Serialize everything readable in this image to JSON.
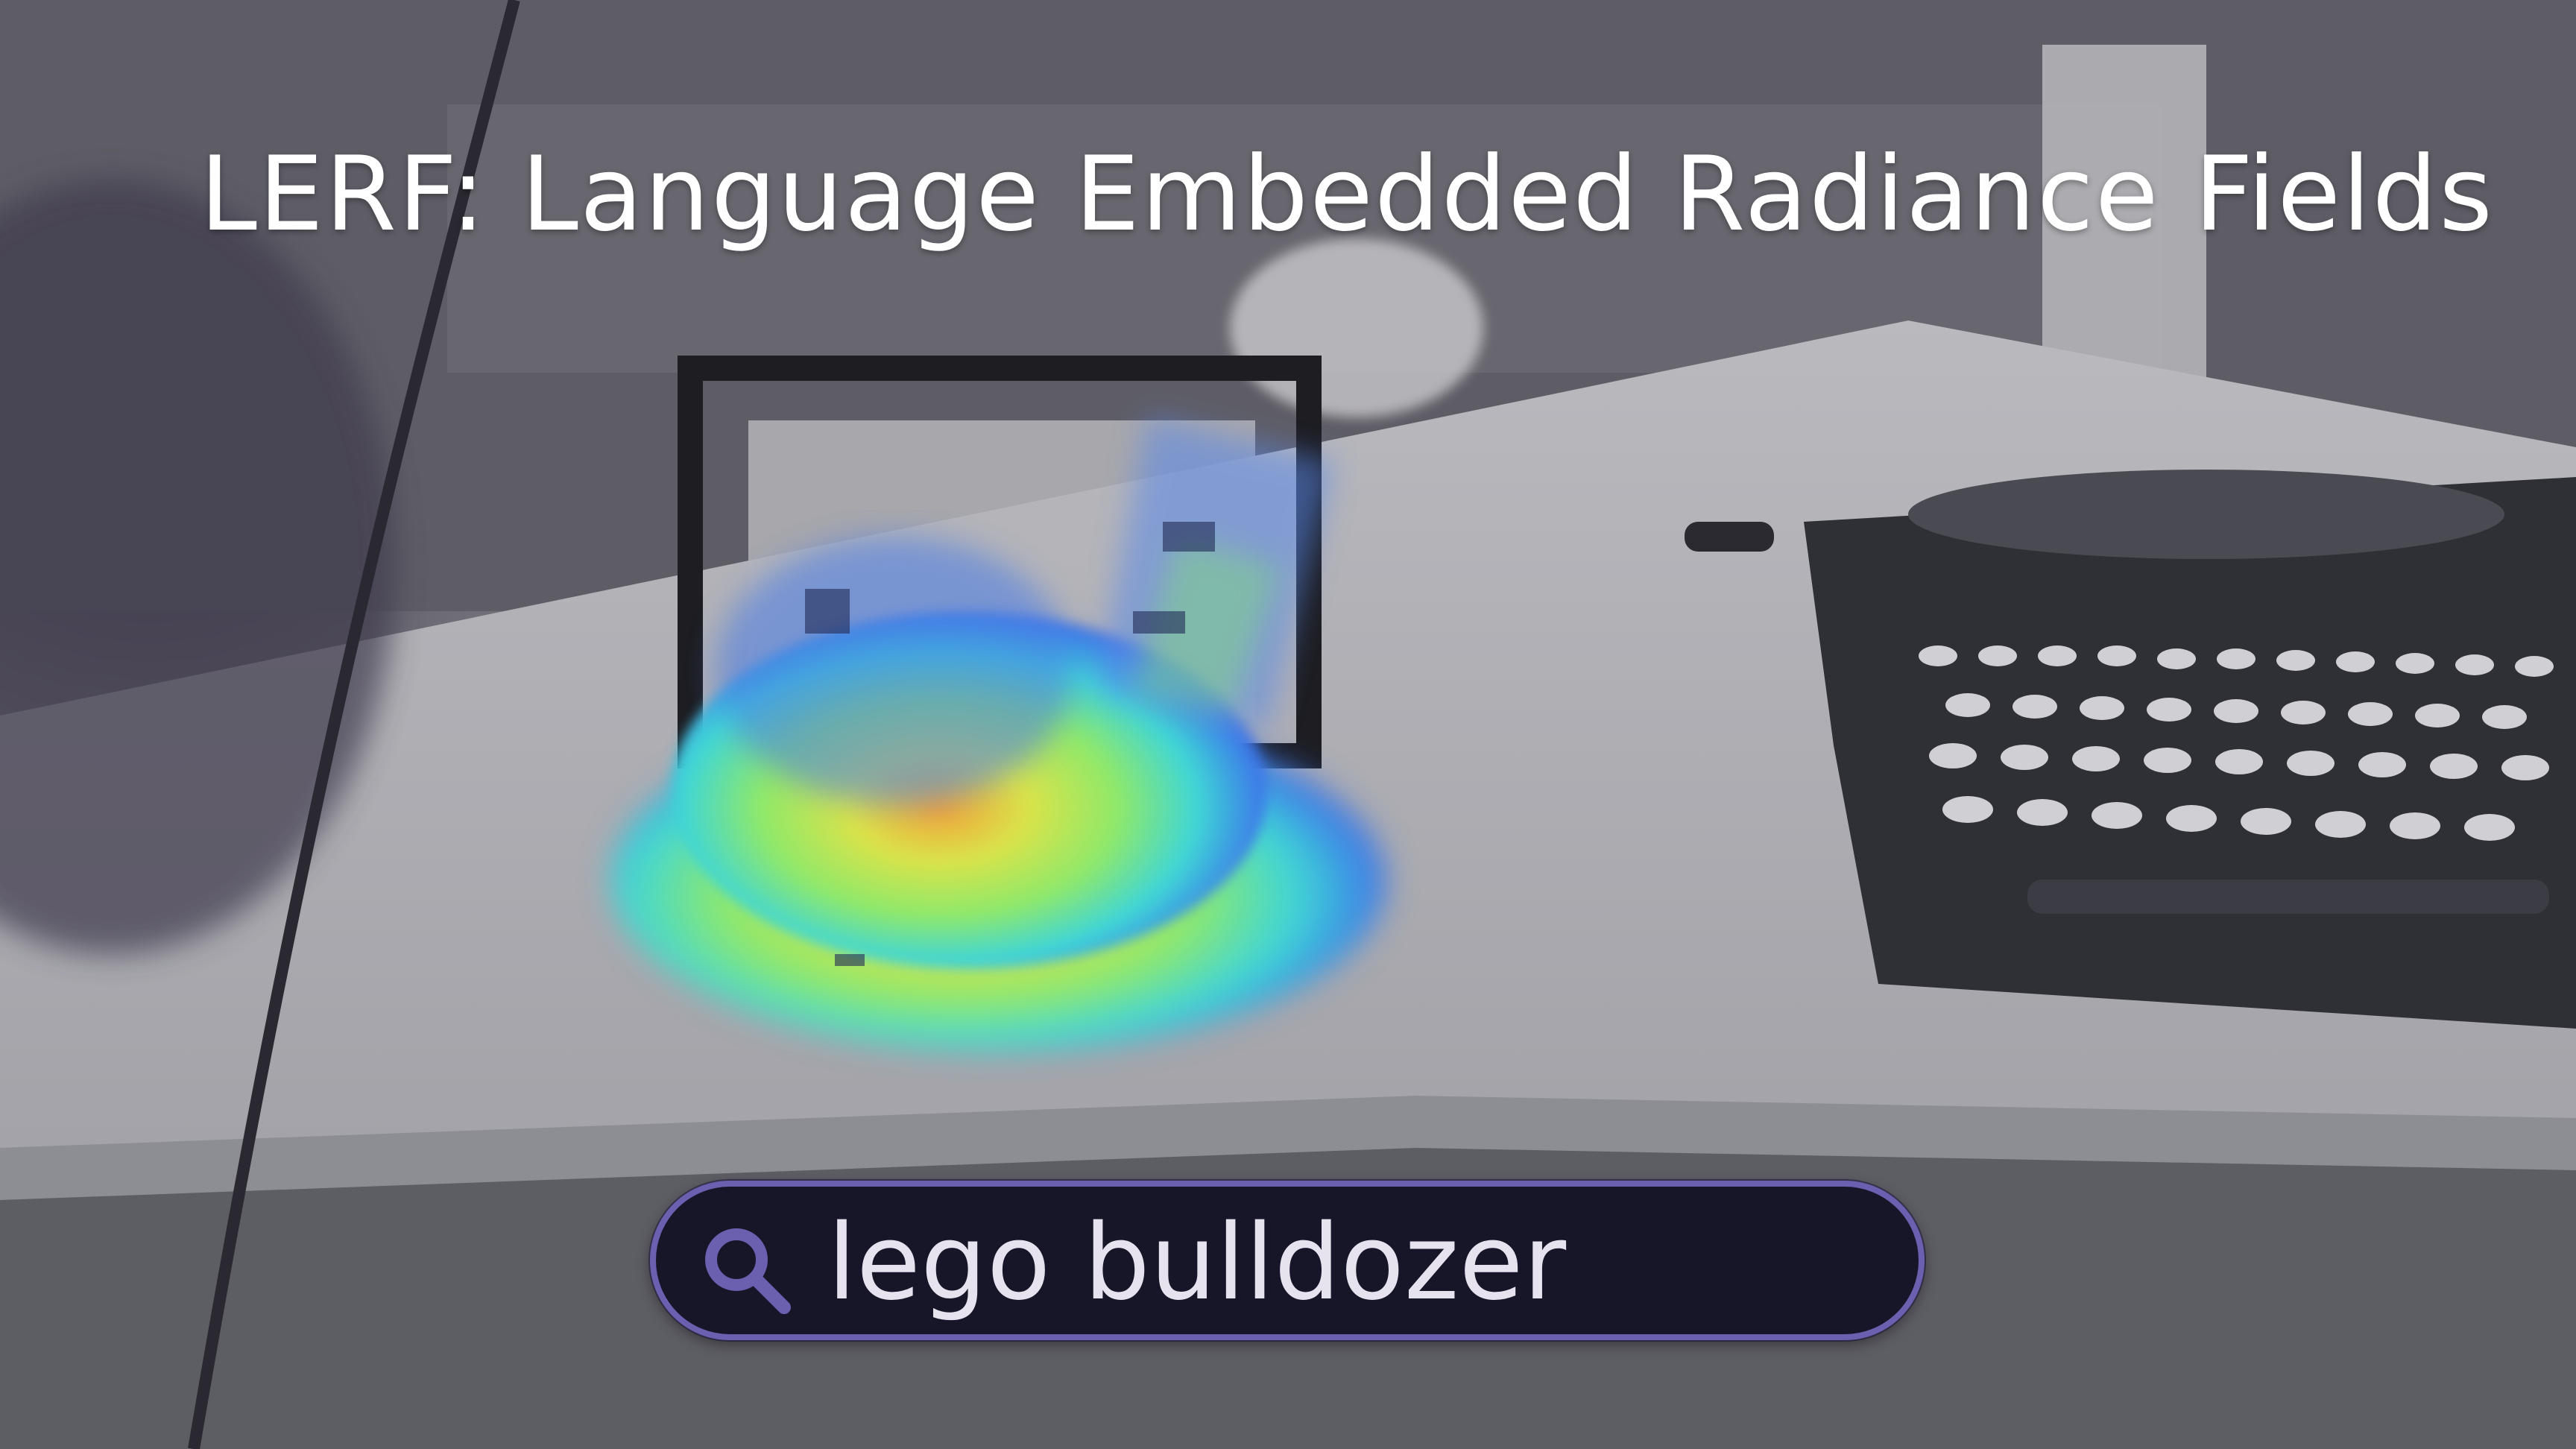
{
  "title": "LERF: Language Embedded Radiance Fields",
  "search": {
    "query": "lego bulldozer",
    "icon": "search-icon"
  },
  "colors": {
    "search_border": "#6b5fb0",
    "search_background": "#161628",
    "title_text": "#ffffff"
  }
}
